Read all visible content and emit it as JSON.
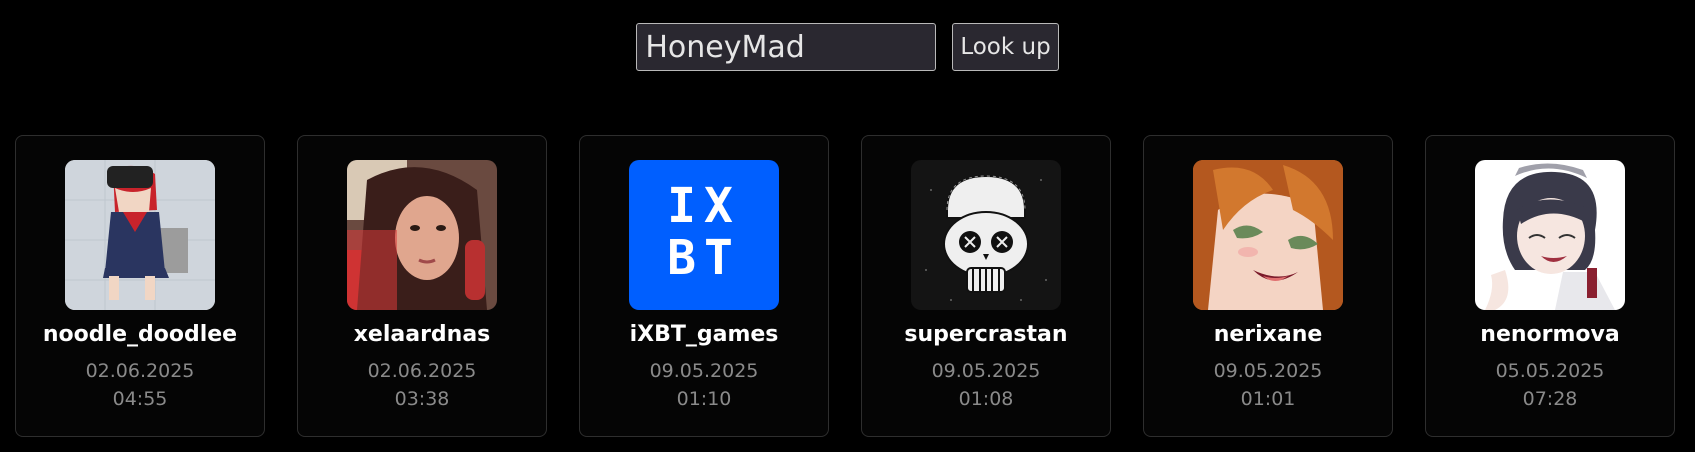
{
  "search": {
    "value": "HoneyMad",
    "button_label": "Look up"
  },
  "users": [
    {
      "name": "noodle_doodlee",
      "date": "02.06.2025",
      "time": "04:55",
      "avatar_icon": "anime-girl-vr-headset-avatar"
    },
    {
      "name": "xelaardnas",
      "date": "02.06.2025",
      "time": "03:38",
      "avatar_icon": "woman-photo-avatar"
    },
    {
      "name": "iXBT_games",
      "date": "09.05.2025",
      "time": "01:10",
      "avatar_icon": "ixbt-logo-avatar",
      "avatar_text_1": "IX",
      "avatar_text_2": "BT"
    },
    {
      "name": "supercrastan",
      "date": "09.05.2025",
      "time": "01:08",
      "avatar_icon": "skull-cap-avatar"
    },
    {
      "name": "nerixane",
      "date": "09.05.2025",
      "time": "01:01",
      "avatar_icon": "anime-redhead-avatar"
    },
    {
      "name": "nenormova",
      "date": "05.05.2025",
      "time": "07:28",
      "avatar_icon": "anime-dark-hair-avatar"
    }
  ],
  "colors": {
    "background": "#000000",
    "ixbt_blue": "#005fff",
    "muted_text": "#8a8a8a"
  }
}
